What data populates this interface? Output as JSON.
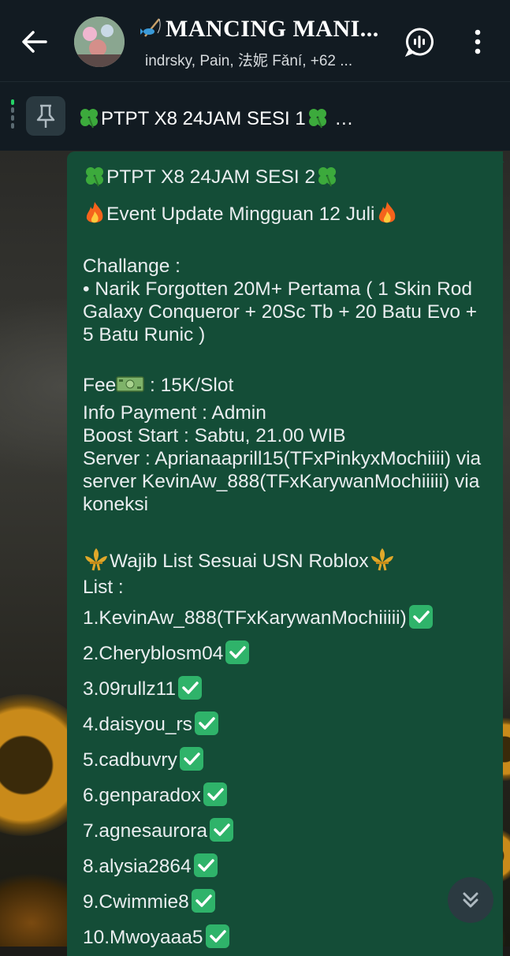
{
  "header": {
    "title": "MANCING MANI...",
    "subtitle": "indrsky, Pain, 法妮 Fǎní, +62 ...",
    "back_icon": "arrow-left-icon",
    "call_icon": "voice-chat-icon",
    "menu_icon": "more-vertical-icon"
  },
  "pinned": {
    "text": "PTPT X8 24JAM SESI 1",
    "ellipsis": "…"
  },
  "message": {
    "title": "PTPT X8 24JAM SESI 2",
    "event": "Event Update Mingguan 12 Juli",
    "challenge_label": "Challange :",
    "challenge_text": "• Narik Forgotten 20M+ Pertama ( 1 Skin Rod Galaxy Conqueror + 20Sc Tb + 20 Batu Evo + 5 Batu Runic )",
    "fee_label": "Fee",
    "fee_value": " : 15K/Slot",
    "info_payment": "Info Payment : Admin",
    "boost_start": "Boost Start : Sabtu, 21.00 WIB",
    "server_text": "Server : Aprianaaprill15(TFxPinkyxMochiiii) via server KevinAw_888(TFxKarywanMochiiiii) via koneksi",
    "wajib": "Wajib List Sesuai USN Roblox",
    "list_label": "List :",
    "list_items": [
      "1.KevinAw_888(TFxKarywanMochiiiii)",
      "2.Cheryblosm04",
      "3.09rullz11",
      "4.daisyou_rs",
      "5.cadbuvry",
      "6.genparadox",
      "7.agnesaurora",
      "8.alysia2864",
      "9.Cwimmie8",
      "10.Mwoyaaa5"
    ]
  },
  "colors": {
    "header_bg": "#121b22",
    "bubble_bg": "#144d37",
    "check_green": "#2fb36a",
    "pin_accent": "#25d366"
  }
}
